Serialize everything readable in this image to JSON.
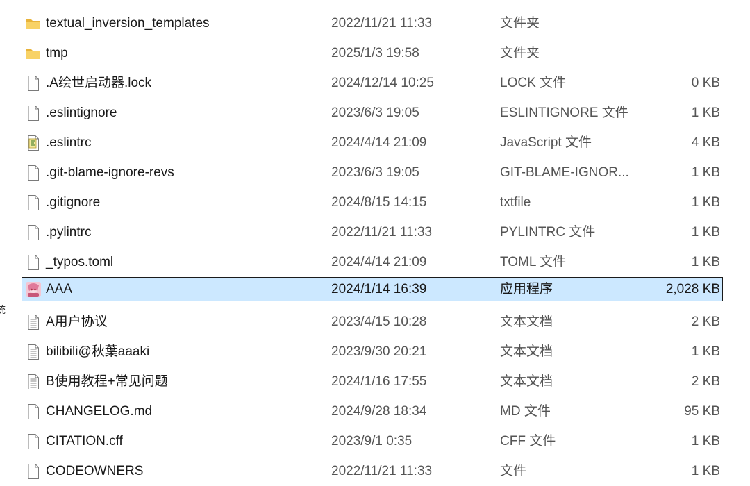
{
  "files": [
    {
      "icon": "folder-icon",
      "name": "textual_inversion_templates",
      "date": "2022/11/21 11:33",
      "type": "文件夹",
      "size": "",
      "selected": false
    },
    {
      "icon": "folder-icon",
      "name": "tmp",
      "date": "2025/1/3 19:58",
      "type": "文件夹",
      "size": "",
      "selected": false
    },
    {
      "icon": "file-icon",
      "name": ".A绘世启动器.lock",
      "date": "2024/12/14 10:25",
      "type": "LOCK 文件",
      "size": "0 KB",
      "selected": false
    },
    {
      "icon": "file-icon",
      "name": ".eslintignore",
      "date": "2023/6/3 19:05",
      "type": "ESLINTIGNORE 文件",
      "size": "1 KB",
      "selected": false
    },
    {
      "icon": "script-file-icon",
      "name": ".eslintrc",
      "date": "2024/4/14 21:09",
      "type": "JavaScript 文件",
      "size": "4 KB",
      "selected": false
    },
    {
      "icon": "file-icon",
      "name": ".git-blame-ignore-revs",
      "date": "2023/6/3 19:05",
      "type": "GIT-BLAME-IGNOR...",
      "size": "1 KB",
      "selected": false
    },
    {
      "icon": "file-icon",
      "name": ".gitignore",
      "date": "2024/8/15 14:15",
      "type": "txtfile",
      "size": "1 KB",
      "selected": false
    },
    {
      "icon": "file-icon",
      "name": ".pylintrc",
      "date": "2022/11/21 11:33",
      "type": "PYLINTRC 文件",
      "size": "1 KB",
      "selected": false
    },
    {
      "icon": "file-icon",
      "name": "_typos.toml",
      "date": "2024/4/14 21:09",
      "type": "TOML 文件",
      "size": "1 KB",
      "selected": false
    },
    {
      "icon": "app-icon",
      "name": "AAA",
      "date": "2024/1/14 16:39",
      "type": "应用程序",
      "size": "2,028 KB",
      "selected": true
    },
    {
      "icon": "text-file-icon",
      "name": "A用户协议",
      "date": "2023/4/15 10:28",
      "type": "文本文档",
      "size": "2 KB",
      "selected": false
    },
    {
      "icon": "text-file-icon",
      "name": "bilibili@秋葉aaaki",
      "date": "2023/9/30 20:21",
      "type": "文本文档",
      "size": "1 KB",
      "selected": false
    },
    {
      "icon": "text-file-icon",
      "name": "B使用教程+常见问题",
      "date": "2024/1/16 17:55",
      "type": "文本文档",
      "size": "2 KB",
      "selected": false
    },
    {
      "icon": "file-icon",
      "name": "CHANGELOG.md",
      "date": "2024/9/28 18:34",
      "type": "MD 文件",
      "size": "95 KB",
      "selected": false
    },
    {
      "icon": "file-icon",
      "name": "CITATION.cff",
      "date": "2023/9/1 0:35",
      "type": "CFF 文件",
      "size": "1 KB",
      "selected": false
    },
    {
      "icon": "file-icon",
      "name": "CODEOWNERS",
      "date": "2022/11/21 11:33",
      "type": "文件",
      "size": "1 KB",
      "selected": false
    }
  ],
  "edge_glyph": "统"
}
